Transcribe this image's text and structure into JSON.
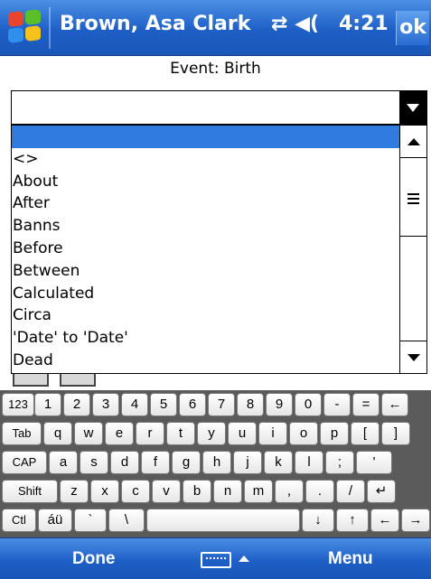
{
  "titlebar": {
    "title": "Brown, Asa Clark",
    "status_glyphs": "⇄ ◀(",
    "time": "4:21",
    "ok_label": "ok",
    "bg": "#1e5fc6"
  },
  "event": {
    "label": "Event: Birth"
  },
  "combo": {
    "value": ""
  },
  "dropdown": {
    "items": [
      "",
      "<>",
      "About",
      "After",
      "Banns",
      "Before",
      "Between",
      "Calculated",
      "Circa",
      "'Date' to 'Date'",
      "Dead"
    ],
    "selected_index": 0,
    "selected_color": "#2f7be0"
  },
  "keyboard": {
    "rows": [
      [
        "123",
        "1",
        "2",
        "3",
        "4",
        "5",
        "6",
        "7",
        "8",
        "9",
        "0",
        "-",
        "=",
        "←"
      ],
      [
        "Tab",
        "q",
        "w",
        "e",
        "r",
        "t",
        "y",
        "u",
        "i",
        "o",
        "p",
        "[",
        "]"
      ],
      [
        "CAP",
        "a",
        "s",
        "d",
        "f",
        "g",
        "h",
        "j",
        "k",
        "l",
        ";",
        "'"
      ],
      [
        "Shift",
        "z",
        "x",
        "c",
        "v",
        "b",
        "n",
        "m",
        ",",
        ".",
        "/",
        "↵"
      ],
      [
        "Ctl",
        "áü",
        "`",
        "\\",
        "",
        "↓",
        "↑",
        "←",
        "→"
      ]
    ]
  },
  "menubar": {
    "left_label": "Done",
    "right_label": "Menu"
  }
}
